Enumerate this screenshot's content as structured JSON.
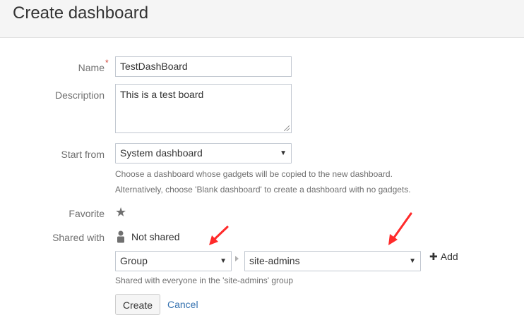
{
  "header": {
    "title": "Create dashboard"
  },
  "form": {
    "name": {
      "label": "Name",
      "required_mark": "*",
      "value": "TestDashBoard"
    },
    "description": {
      "label": "Description",
      "value": "This is a test board"
    },
    "start_from": {
      "label": "Start from",
      "selected": "System dashboard",
      "help_line1": "Choose a dashboard whose gadgets will be copied to the new dashboard.",
      "help_line2": "Alternatively, choose 'Blank dashboard' to create a dashboard with no gadgets."
    },
    "favorite": {
      "label": "Favorite",
      "icon": "star-icon"
    },
    "shared_with": {
      "label": "Shared with",
      "status": "Not shared",
      "type_selected": "Group",
      "group_selected": "site-admins",
      "add_label": "Add",
      "help": "Shared with everyone in the 'site-admins' group"
    }
  },
  "actions": {
    "create_label": "Create",
    "cancel_label": "Cancel"
  },
  "colors": {
    "required": "#d04437",
    "link": "#3572b0",
    "annotation_arrow": "#ff2a2a"
  }
}
